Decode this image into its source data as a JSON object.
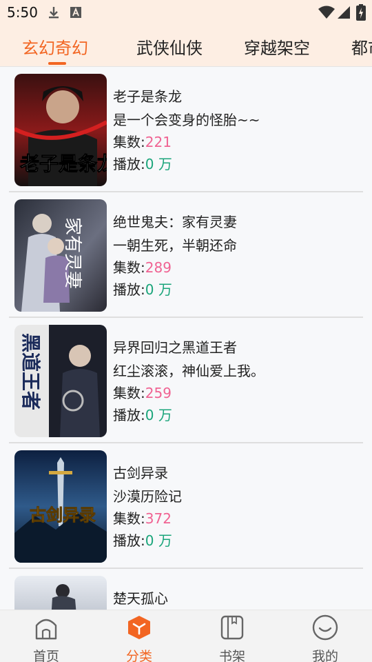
{
  "status_bar": {
    "time": "5:50",
    "icons": [
      "download-icon",
      "a-box-icon",
      "wifi-icon",
      "signal-icon",
      "battery-icon"
    ]
  },
  "tabs": [
    {
      "label": "玄幻奇幻",
      "active": true
    },
    {
      "label": "武侠仙侠",
      "active": false
    },
    {
      "label": "穿越架空",
      "active": false
    },
    {
      "label": "都市",
      "active": false
    }
  ],
  "books": [
    {
      "title": "老子是条龙",
      "desc": "是一个会变身的怪胎~~",
      "count_label": "集数:",
      "count": "221",
      "play_label": "播放:",
      "play": "0 万",
      "cover_text": "老子是条龙"
    },
    {
      "title": "绝世鬼夫：家有灵妻",
      "desc": "一朝生死，半朝还命",
      "count_label": "集数:",
      "count": "289",
      "play_label": "播放:",
      "play": "0 万",
      "cover_text": "家有灵妻"
    },
    {
      "title": "异界回归之黑道王者",
      "desc": "红尘滚滚，神仙爱上我。",
      "count_label": "集数:",
      "count": "259",
      "play_label": "播放:",
      "play": "0 万",
      "cover_text": "黑道王者"
    },
    {
      "title": "古剑异录",
      "desc": "沙漠历险记",
      "count_label": "集数:",
      "count": "372",
      "play_label": "播放:",
      "play": "0 万",
      "cover_text": "古剑异录"
    },
    {
      "title": "楚天孤心",
      "desc": "",
      "count_label": "",
      "count": "",
      "play_label": "",
      "play": "",
      "cover_text": ""
    }
  ],
  "bottom_nav": [
    {
      "label": "首页",
      "icon": "home-icon",
      "active": false
    },
    {
      "label": "分类",
      "icon": "category-cube-icon",
      "active": true
    },
    {
      "label": "书架",
      "icon": "bookshelf-icon",
      "active": false
    },
    {
      "label": "我的",
      "icon": "profile-smile-icon",
      "active": false
    }
  ],
  "colors": {
    "accent": "#f26522",
    "count": "#f06292",
    "play": "#1aa57a",
    "header_bg": "#fdeee3"
  }
}
